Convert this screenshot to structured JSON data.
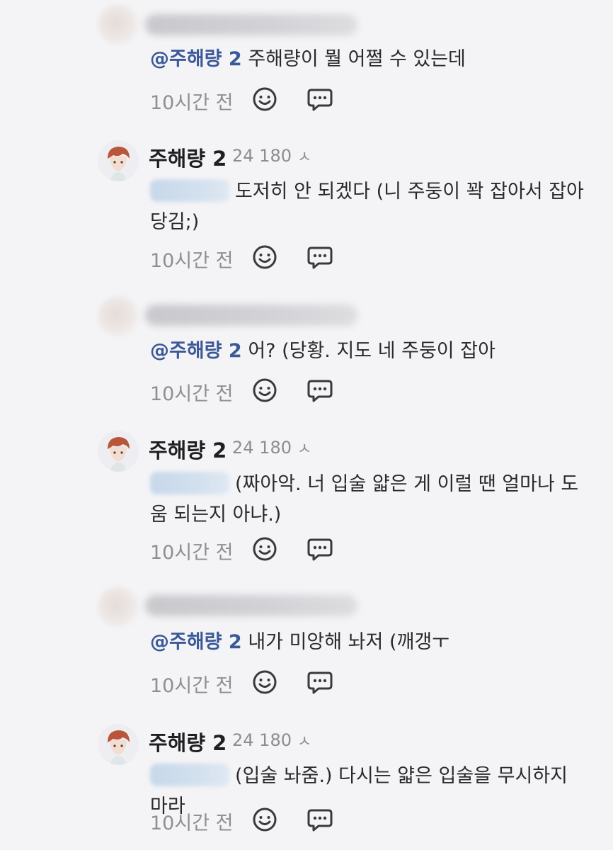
{
  "comments": [
    {
      "type": "other",
      "mention": "@주해량 2",
      "text": "주해량이 뭘 어쩔 수 있는데",
      "time": "10시간 전"
    },
    {
      "type": "author",
      "author": "주해량 2",
      "meta": "24 180",
      "meta_icon": "person-icon",
      "text": "도저히 안 되겠다 (니 주둥이 꽉 잡아서 잡아당김;)",
      "time": "10시간 전"
    },
    {
      "type": "other",
      "mention": "@주해량 2",
      "text": "어? (당황. 지도 네 주둥이 잡아",
      "time": "10시간 전"
    },
    {
      "type": "author",
      "author": "주해량 2",
      "meta": "24 180",
      "meta_icon": "person-icon",
      "text": "(짜아악. 너 입술 얇은 게 이럴 땐 얼마나 도움 되는지 아냐.)",
      "time": "10시간 전"
    },
    {
      "type": "other",
      "mention": "@주해량 2",
      "text": "내가 미앙해 놔저 (깨갱ㅜ",
      "time": "10시간 전"
    },
    {
      "type": "author",
      "author": "주해량 2",
      "meta": "24 180",
      "meta_icon": "person-icon",
      "text": "(입술 놔줌.) 다시는 얇은 입술을 무시하지 마라",
      "time": "10시간 전"
    }
  ],
  "icons": {
    "emoji": "smiley-icon",
    "reply": "reply-bubble-icon"
  },
  "colors": {
    "background": "#f4f4f6",
    "mention": "#3b5998",
    "muted": "#8e8e93",
    "text": "#2a2a2d"
  }
}
